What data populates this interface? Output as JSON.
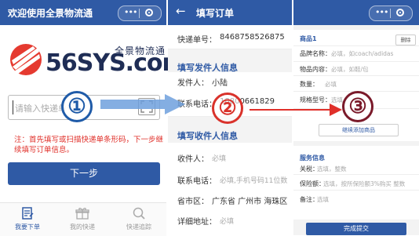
{
  "panel1": {
    "title": "欢迎使用全景物流通",
    "logo_text": "56SYS.com",
    "logo_cn": "全景物流通",
    "input_placeholder": "请输入快递单号",
    "note": "注：首先填写或扫描快递单条形码，下一步继续填写订单信息。",
    "next_button": "下一步",
    "tabs": [
      {
        "label": "我要下单",
        "icon": "order-icon",
        "active": true
      },
      {
        "label": "我的快递",
        "icon": "gift-icon",
        "active": false
      },
      {
        "label": "快递追踪",
        "icon": "search-icon",
        "active": false
      }
    ]
  },
  "panel2": {
    "title": "填写订单",
    "back_icon": "arrow-left-icon",
    "tracking_label": "快递单号：",
    "tracking_value": "8468758526875",
    "sender_section": "填写发件人信息",
    "sender_name_label": "发件人：",
    "sender_name_value": "小陆",
    "sender_phone_label": "联系电话：",
    "sender_phone_value": "18800661829",
    "recipient_section": "填写收件人信息",
    "recipient_name_label": "收件人：",
    "recipient_name_placeholder": "必填",
    "recipient_phone_label": "联系电话：",
    "recipient_phone_placeholder": "必填,手机号码11位数",
    "region_label": "省市区：",
    "region_value": "广东省 广州市 海珠区",
    "address_label": "详细地址：",
    "address_placeholder": "必填"
  },
  "panel3": {
    "goods_title": "商品1",
    "delete_button": "删除",
    "brand_label": "品牌名称：",
    "brand_placeholder": "必填，如coach/adidas",
    "content_label": "物品内容：",
    "content_placeholder": "必填，如鞋/包",
    "qty_label": "数量：",
    "qty_placeholder": "必填",
    "spec_label": "规格型号：",
    "spec_placeholder": "选填",
    "add_goods_button": "继续添加商品",
    "service_title": "服务信息",
    "tax_label": "关税：",
    "tax_placeholder": "选填，整数",
    "insure_label": "保险额：",
    "insure_placeholder": "选填，按所保险额3%购买 整数",
    "remark_label": "备注：",
    "remark_placeholder": "选填",
    "submit_button": "完成提交"
  },
  "annotations": {
    "step1": "①",
    "step2": "②",
    "step3": "③",
    "colors": {
      "step1": "#1f5ba8",
      "step2": "#d9322b",
      "step3": "#7a1a2a",
      "brand": "#2f5aa5"
    }
  }
}
